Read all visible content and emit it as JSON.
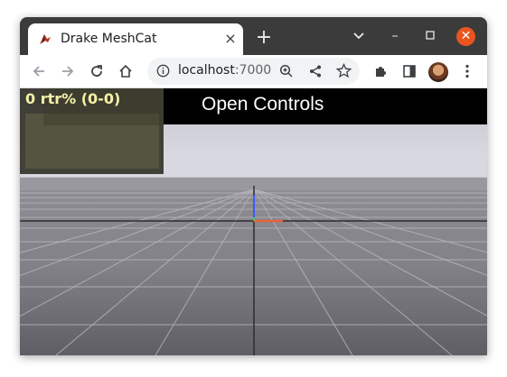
{
  "browser": {
    "tab": {
      "title": "Drake MeshCat",
      "favicon": "drake-logo-icon",
      "close_glyph": "×"
    },
    "new_tab_glyph": "+",
    "window_controls": {
      "chevron": "⌄",
      "minimize": "–",
      "maximize": "☐",
      "close": "✕"
    },
    "toolbar": {
      "back_icon": "arrow-left-icon",
      "forward_icon": "arrow-right-icon",
      "reload_icon": "reload-icon",
      "home_icon": "home-icon",
      "address_host": "localhost",
      "address_port": ":7000",
      "site_info_icon": "info-icon",
      "zoom_icon": "zoom-icon",
      "share_icon": "share-icon",
      "bookmark_icon": "star-icon",
      "extensions_icon": "puzzle-icon",
      "side_panel_icon": "side-panel-icon",
      "menu_icon": "kebab-menu-icon"
    }
  },
  "meshcat": {
    "stats_text": "0 rtr% (0-0)",
    "controls_label": "Open Controls",
    "axis_colors": {
      "x": "#e8603a",
      "y": "#49c45a",
      "z": "#3a5cff"
    }
  }
}
